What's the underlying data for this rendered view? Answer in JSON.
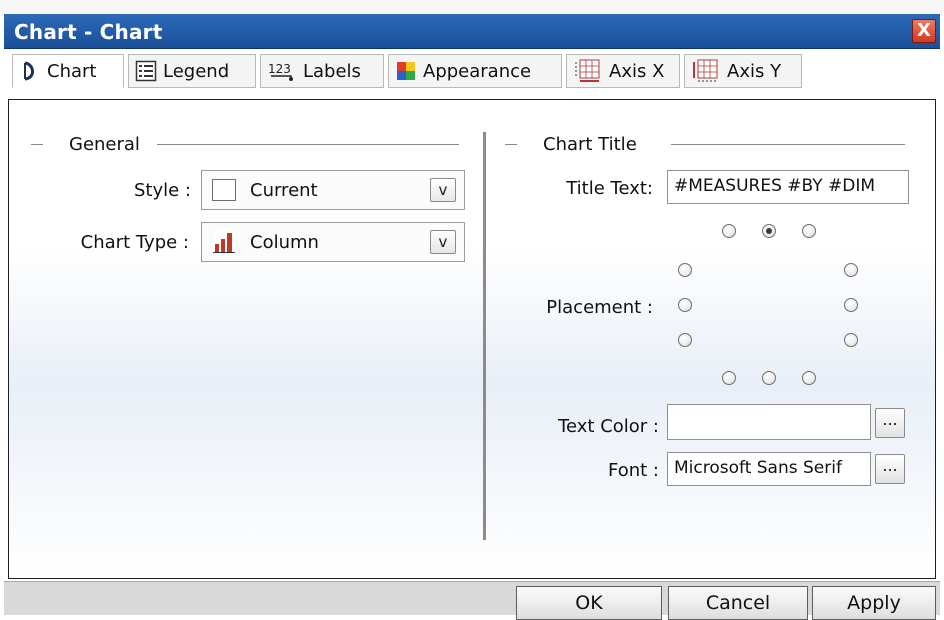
{
  "window": {
    "title": "Chart - Chart",
    "close_glyph": "X"
  },
  "tabs": [
    {
      "label": "Chart",
      "icon": "chart-tab-icon",
      "active": true
    },
    {
      "label": "Legend",
      "icon": "legend-icon",
      "active": false
    },
    {
      "label": "Labels",
      "icon": "labels-123-icon",
      "active": false
    },
    {
      "label": "Appearance",
      "icon": "appearance-palette-icon",
      "active": false
    },
    {
      "label": "Axis X",
      "icon": "axis-x-icon",
      "active": false
    },
    {
      "label": "Axis Y",
      "icon": "axis-y-icon",
      "active": false
    }
  ],
  "general": {
    "heading": "General",
    "style_label": "Style :",
    "style_value": "Current",
    "chart_type_label": "Chart Type :",
    "chart_type_value": "Column",
    "dropdown_glyph": "v"
  },
  "chart_title": {
    "heading": "Chart Title",
    "title_text_label": "Title Text:",
    "title_text_value": "#MEASURES #BY #DIM",
    "placement_label": "Placement :",
    "placement_selected": "top-center",
    "text_color_label": "Text Color :",
    "text_color_value": "",
    "font_label": "Font :",
    "font_value": "Microsoft Sans Serif",
    "browse_glyph": "..."
  },
  "footer": {
    "ok_label": "OK",
    "cancel_label": "Cancel",
    "apply_label": "Apply"
  },
  "colors": {
    "titlebar": "#1b4f98",
    "close": "#d2391f",
    "column_icon": "#c0392b"
  }
}
